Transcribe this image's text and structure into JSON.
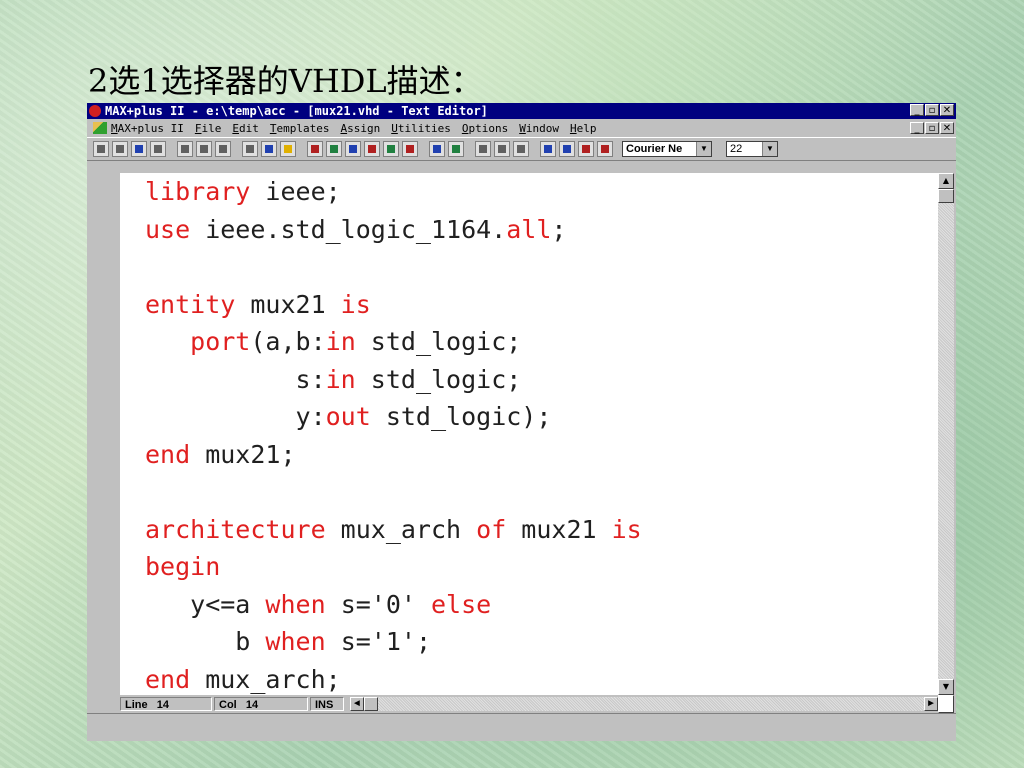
{
  "slide": {
    "title": "2选1选择器的VHDL描述："
  },
  "window": {
    "title": "MAX+plus II - e:\\temp\\acc - [mux21.vhd - Text Editor]",
    "controls": {
      "minimize": "_",
      "maximize": "▫",
      "close": "✕"
    }
  },
  "menu": {
    "items": [
      "MAX+plus II",
      "File",
      "Edit",
      "Templates",
      "Assign",
      "Utilities",
      "Options",
      "Window",
      "Help"
    ]
  },
  "toolbar": {
    "icons": [
      "new-icon",
      "open-icon",
      "save-icon",
      "print-icon",
      "cut-icon",
      "copy-icon",
      "paste-icon",
      "undo-icon",
      "help-cursor-icon",
      "hierarchy-icon",
      "compile-icon",
      "simulate-icon",
      "timing-icon",
      "programmer-icon",
      "floorplan-icon",
      "project-save-icon",
      "project-check-icon",
      "project-compile-icon",
      "floppy-icon",
      "floppy2-icon",
      "floppy3-icon",
      "find-icon",
      "find-next-icon",
      "replace-icon",
      "replace-all-icon"
    ],
    "font": "Courier Ne",
    "size": "22"
  },
  "code": [
    [
      {
        "t": "library",
        "k": true
      },
      {
        "t": " ieee;"
      }
    ],
    [
      {
        "t": "use",
        "k": true
      },
      {
        "t": " ieee.std_logic_1164."
      },
      {
        "t": "all",
        "k": true
      },
      {
        "t": ";"
      }
    ],
    [],
    [
      {
        "t": "entity",
        "k": true
      },
      {
        "t": " mux21 "
      },
      {
        "t": "is",
        "k": true
      }
    ],
    [
      {
        "t": "   "
      },
      {
        "t": "port",
        "k": true
      },
      {
        "t": "(a,b:"
      },
      {
        "t": "in",
        "k": true
      },
      {
        "t": " std_logic;"
      }
    ],
    [
      {
        "t": "          s:"
      },
      {
        "t": "in",
        "k": true
      },
      {
        "t": " std_logic;"
      }
    ],
    [
      {
        "t": "          y:"
      },
      {
        "t": "out",
        "k": true
      },
      {
        "t": " std_logic);"
      }
    ],
    [
      {
        "t": "end",
        "k": true
      },
      {
        "t": " mux21;"
      }
    ],
    [],
    [
      {
        "t": "architecture",
        "k": true
      },
      {
        "t": " mux_arch "
      },
      {
        "t": "of",
        "k": true
      },
      {
        "t": " mux21 "
      },
      {
        "t": "is",
        "k": true
      }
    ],
    [
      {
        "t": "begin",
        "k": true
      }
    ],
    [
      {
        "t": "   y<=a "
      },
      {
        "t": "when",
        "k": true
      },
      {
        "t": " s='0' "
      },
      {
        "t": "else",
        "k": true
      }
    ],
    [
      {
        "t": "      b "
      },
      {
        "t": "when",
        "k": true
      },
      {
        "t": " s='1';"
      }
    ],
    [
      {
        "t": "end",
        "k": true
      },
      {
        "t": " mux_arch;"
      }
    ]
  ],
  "status": {
    "line_label": "Line",
    "line": "14",
    "col_label": "Col",
    "col": "14",
    "mode": "INS"
  },
  "colors": {
    "keyword": "#e02020",
    "titlebar": "#000080",
    "chrome": "#c0c0c0"
  }
}
